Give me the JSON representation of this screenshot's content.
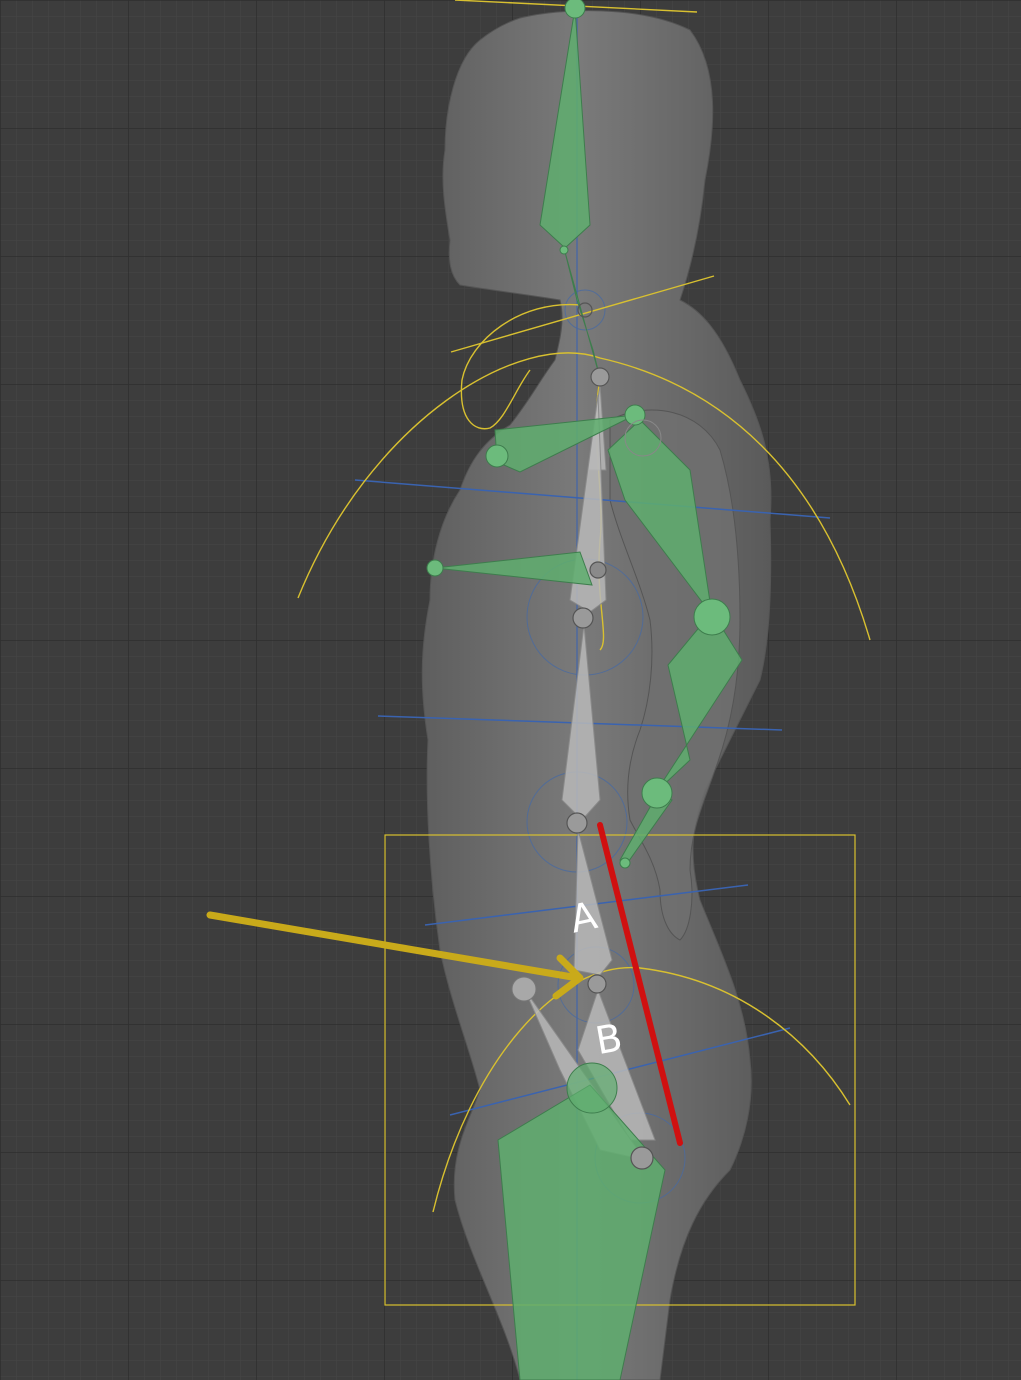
{
  "viewport": {
    "background": "#3d3d3d",
    "grid_minor_color": "#474747",
    "grid_major_color": "#2e2e2e"
  },
  "mesh": {
    "color": "#6e6e6e"
  },
  "colors": {
    "bone_green": "#5fae6f",
    "bone_green_dark": "#3e7d4d",
    "bone_grey": "#b8b8b8",
    "selection_yellow": "#d8c030",
    "axis_blue": "#3a63b0",
    "annotation_red": "#d01010",
    "annotation_arrow": "#c9aa1a"
  },
  "annotations": {
    "label_a": "A",
    "label_b": "B"
  }
}
